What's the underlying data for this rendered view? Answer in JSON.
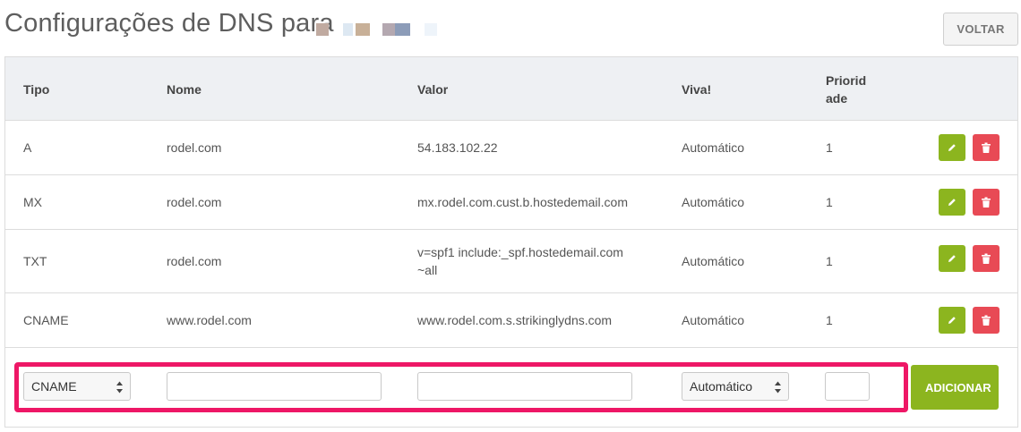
{
  "page": {
    "title": "Configurações de DNS para",
    "back_label": "VOLTAR"
  },
  "table": {
    "headers": {
      "tipo": "Tipo",
      "nome": "Nome",
      "valor": "Valor",
      "viva": "Viva!",
      "prioridade": "Priorid ade"
    },
    "rows": [
      {
        "tipo": "A",
        "nome": "rodel.com",
        "valor": "54.183.102.22",
        "viva": "Automático",
        "prioridade": "1"
      },
      {
        "tipo": "MX",
        "nome": "rodel.com",
        "valor": "mx.rodel.com.cust.b.hostedemail.com",
        "viva": "Automático",
        "prioridade": "1"
      },
      {
        "tipo": "TXT",
        "nome": "rodel.com",
        "valor": "v=spf1 include:_spf.hostedemail.com ~all",
        "viva": "Automático",
        "prioridade": "1"
      },
      {
        "tipo": "CNAME",
        "nome": "www.rodel.com",
        "valor": "www.rodel.com.s.strikinglydns.com",
        "viva": "Automático",
        "prioridade": "1"
      }
    ],
    "row_actions": {
      "edit_icon": "pencil-icon",
      "delete_icon": "trash-icon"
    }
  },
  "form": {
    "tipo_selected": "CNAME",
    "nome_value": "",
    "valor_value": "",
    "viva_selected": "Automático",
    "prioridade_value": "",
    "add_label": "ADICIONAR"
  },
  "colors": {
    "accent_green": "#8cb51f",
    "danger_red": "#e84a55",
    "highlight_pink": "#ee1766",
    "header_bg": "#eef0f3"
  }
}
